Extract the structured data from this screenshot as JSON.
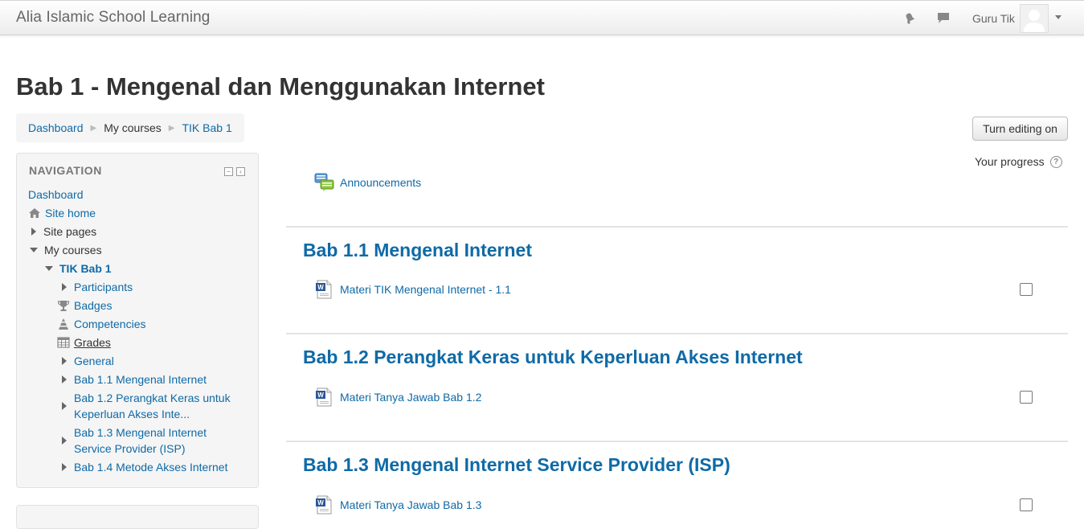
{
  "navbar": {
    "site_name": "Alia Islamic School Learning",
    "user_name": "Guru Tik",
    "icons": [
      "bell-icon",
      "message-icon",
      "avatar",
      "caret-down-icon"
    ]
  },
  "page": {
    "title": "Bab 1 - Mengenal dan Menggunakan Internet",
    "breadcrumb": [
      "Dashboard",
      "My courses",
      "TIK Bab 1"
    ],
    "edit_button": "Turn editing on",
    "progress_label": "Your progress",
    "help_glyph": "?"
  },
  "navigation": {
    "title": "NAVIGATION",
    "items": [
      {
        "label": "Dashboard"
      },
      {
        "label": "Site home",
        "icon": "home-icon"
      },
      {
        "label": "Site pages"
      },
      {
        "label": "My courses"
      },
      {
        "label": "TIK Bab 1"
      },
      {
        "label": "Participants"
      },
      {
        "label": "Badges",
        "icon": "trophy-icon"
      },
      {
        "label": "Competencies",
        "icon": "competencies-icon"
      },
      {
        "label": "Grades",
        "icon": "grades-table-icon"
      },
      {
        "label": "General"
      },
      {
        "label": "Bab 1.1 Mengenal Internet"
      },
      {
        "label_line1": "Bab 1.2 Perangkat Keras untuk",
        "label_line2": "Keperluan Akses Inte..."
      },
      {
        "label_line1": "Bab 1.3 Mengenal Internet",
        "label_line2": "Service Provider (ISP)"
      },
      {
        "label": "Bab 1.4 Metode Akses Internet"
      }
    ]
  },
  "main": {
    "announcements": "Announcements",
    "sections": [
      {
        "title": "Bab 1.1 Mengenal Internet",
        "activity": "Materi TIK Mengenal Internet - 1.1"
      },
      {
        "title": "Bab 1.2 Perangkat Keras untuk Keperluan Akses Internet",
        "activity": "Materi Tanya Jawab Bab 1.2"
      },
      {
        "title": "Bab 1.3 Mengenal Internet Service Provider (ISP)",
        "activity": "Materi Tanya Jawab Bab 1.3"
      }
    ]
  },
  "colors": {
    "link": "#0f6aa6",
    "text": "#333333",
    "block_bg": "#f5f5f5"
  }
}
